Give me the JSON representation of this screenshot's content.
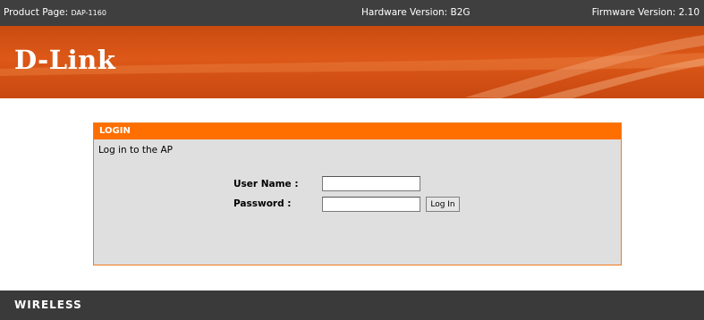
{
  "topbar": {
    "product_label": "Product Page:",
    "product_model": "DAP-1160",
    "hardware": "Hardware Version: B2G",
    "firmware": "Firmware Version: 2.10"
  },
  "brand": {
    "logo": "D-Link"
  },
  "login": {
    "header": "LOGIN",
    "description": "Log in to the AP",
    "username_label": "User Name :",
    "username_value": "",
    "password_label": "Password :",
    "password_value": "",
    "button_label": "Log In"
  },
  "footer": {
    "label": "WIRELESS"
  },
  "colors": {
    "topbar": "#3f3f3f",
    "banner": "#dd5818",
    "panel_header": "#ff6f00",
    "panel_body": "#dfdfdf",
    "footer": "#3a3a3a"
  }
}
